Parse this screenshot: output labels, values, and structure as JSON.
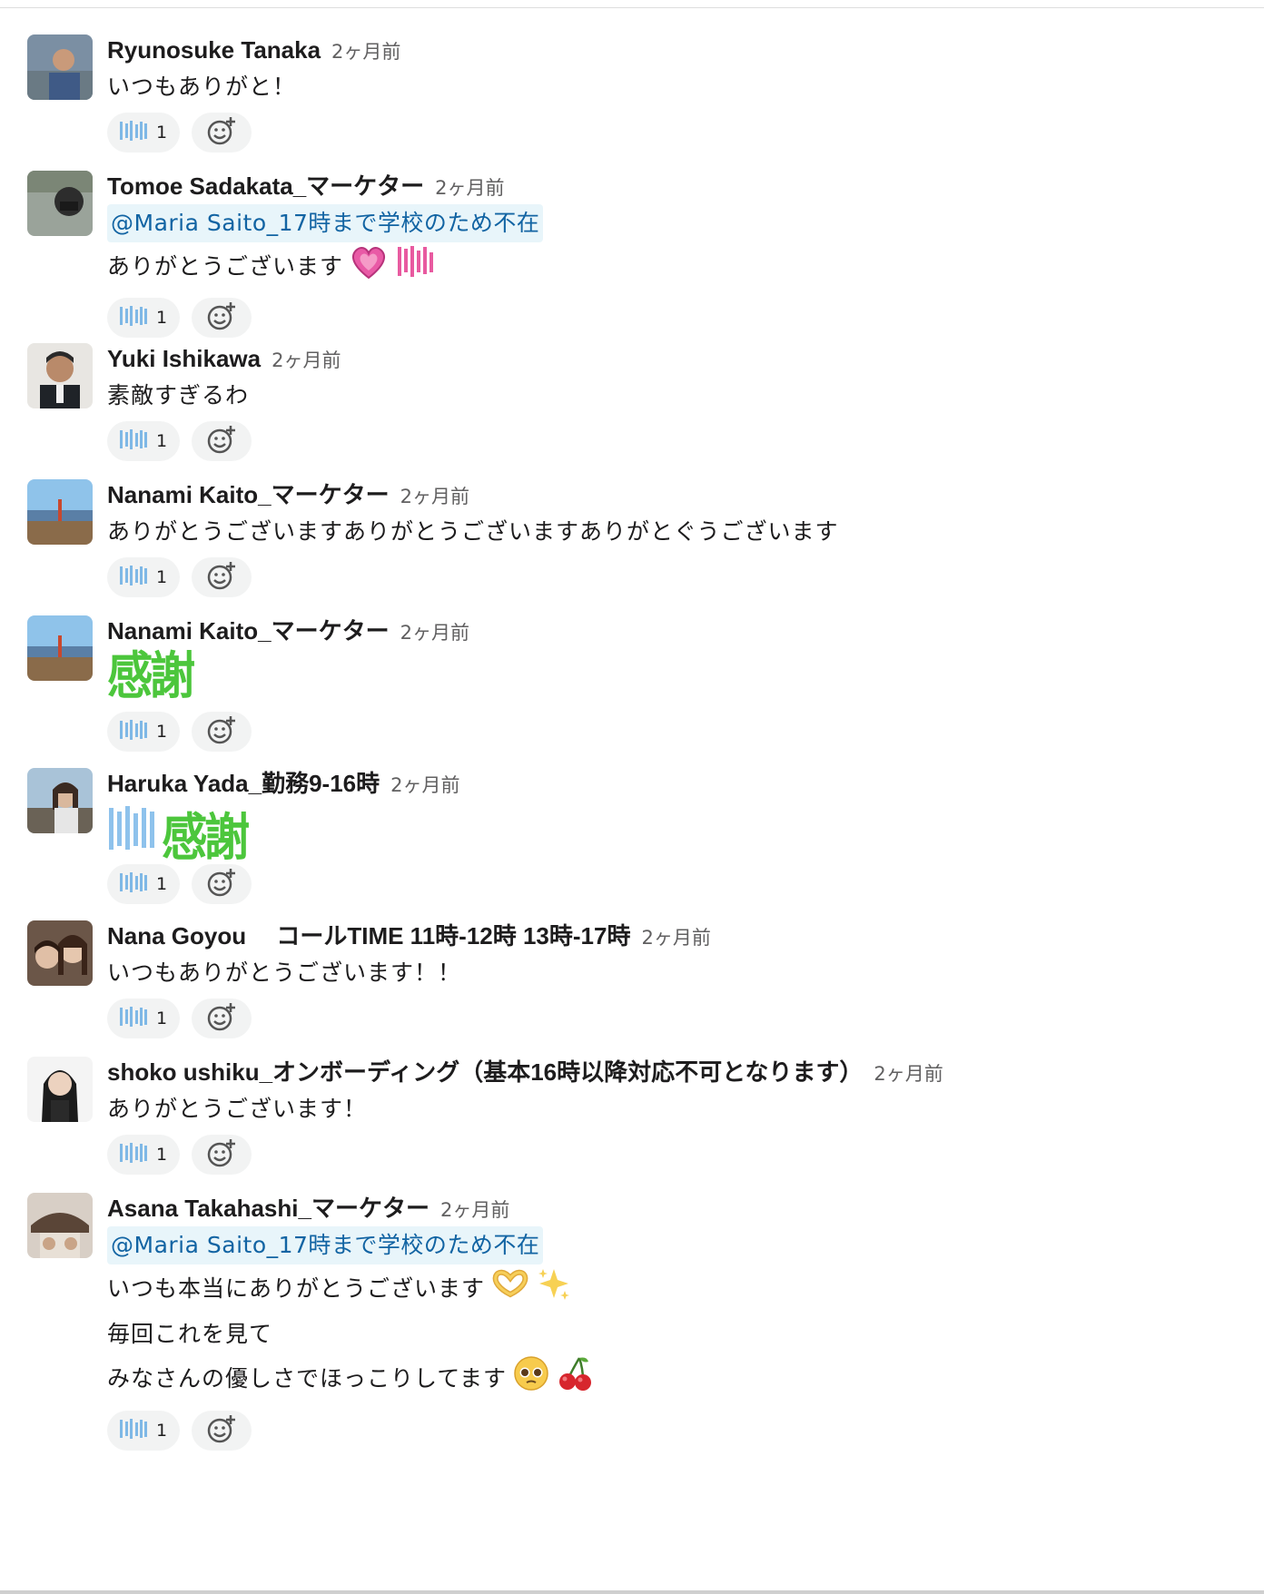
{
  "messages": [
    {
      "author": "Ryunosuke Tanaka",
      "time": "2ヶ月前",
      "lines": [
        "いつもありがと！"
      ],
      "reaction_count": "1"
    },
    {
      "author": "Tomoe Sadakata_マーケター",
      "time": "2ヶ月前",
      "mention": "@Maria Saito_17時まで学校のため不在",
      "lines": [
        "ありがとうございます"
      ],
      "reaction_count": "1"
    },
    {
      "author": "Yuki Ishikawa",
      "time": "2ヶ月前",
      "lines": [
        "素敵すぎるわ"
      ],
      "reaction_count": "1"
    },
    {
      "author": "Nanami Kaito_マーケター",
      "time": "2ヶ月前",
      "lines": [
        "ありがとうございますありがとうございますありがとぐうございます"
      ],
      "reaction_count": "1"
    },
    {
      "author": "Nanami Kaito_マーケター",
      "time": "2ヶ月前",
      "stamp_text": "感謝",
      "reaction_count": "1"
    },
    {
      "author": "Haruka Yada_勤務9-16時",
      "time": "2ヶ月前",
      "stamp_text": "感謝",
      "reaction_count": "1"
    },
    {
      "author": "Nana Goyou　 コールTIME 11時-12時 13時-17時",
      "time": "2ヶ月前",
      "lines": [
        "いつもありがとうございます！！"
      ],
      "reaction_count": "1"
    },
    {
      "author": "shoko ushiku_オンボーディング（基本16時以降対応不可となります）",
      "time": "2ヶ月前",
      "lines": [
        "ありがとうございます！"
      ],
      "reaction_count": "1"
    },
    {
      "author": "Asana Takahashi_マーケター",
      "time": "2ヶ月前",
      "mention": "@Maria Saito_17時まで学校のため不在",
      "lines": [
        "いつも本当にありがとうございます",
        "毎回これを見て",
        "みなさんの優しさでほっこりしてます"
      ],
      "reaction_count": "1"
    }
  ],
  "icons": {
    "reaction": "arigatou-stamp-icon",
    "add_reaction": "add-reaction-icon",
    "heart": "growing-heart-icon",
    "kansha_desu": "kansha-desu-stamp-icon",
    "hands": "heart-hands-icon",
    "sparkles": "sparkles-icon",
    "pleading": "pleading-face-icon",
    "cherries": "cherries-icon"
  },
  "colors": {
    "mention_bg": "#e8f5fa",
    "mention_text": "#1264a3",
    "kansha_green": "#4cc63c",
    "reaction_bg": "#f2f3f3"
  }
}
